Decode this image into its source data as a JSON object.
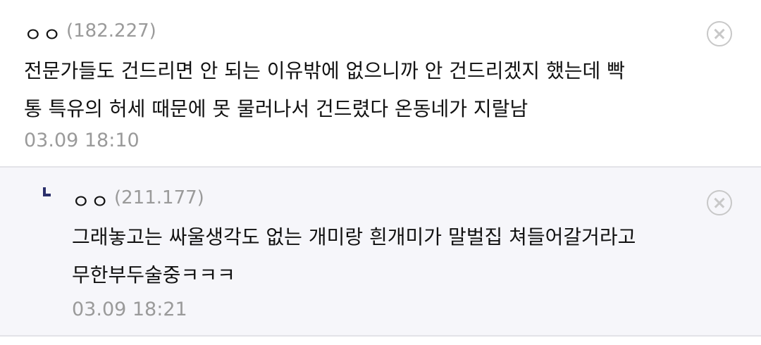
{
  "comments": [
    {
      "nickname": "ㅇㅇ",
      "ip": "(182.227)",
      "lines": [
        "전문가들도 건드리면 안 되는 이유밖에 없으니까 안 건드리겠지 했는데 빡",
        "통 특유의 허세 때문에 못 물러나서 건드렸다 온동네가 지랄남"
      ],
      "date": "03.09 18:10",
      "close_icon": "close-circle-icon"
    },
    {
      "reply_icon": "reply-arrow-icon",
      "nickname": "ㅇㅇ",
      "ip": "(211.177)",
      "lines": [
        "그래놓고는 싸울생각도 없는 개미랑 흰개미가 말벌집 쳐들어갈거라고",
        "무한부두술중ㅋㅋㅋ"
      ],
      "date": "03.09 18:21",
      "close_icon": "close-circle-icon"
    }
  ]
}
